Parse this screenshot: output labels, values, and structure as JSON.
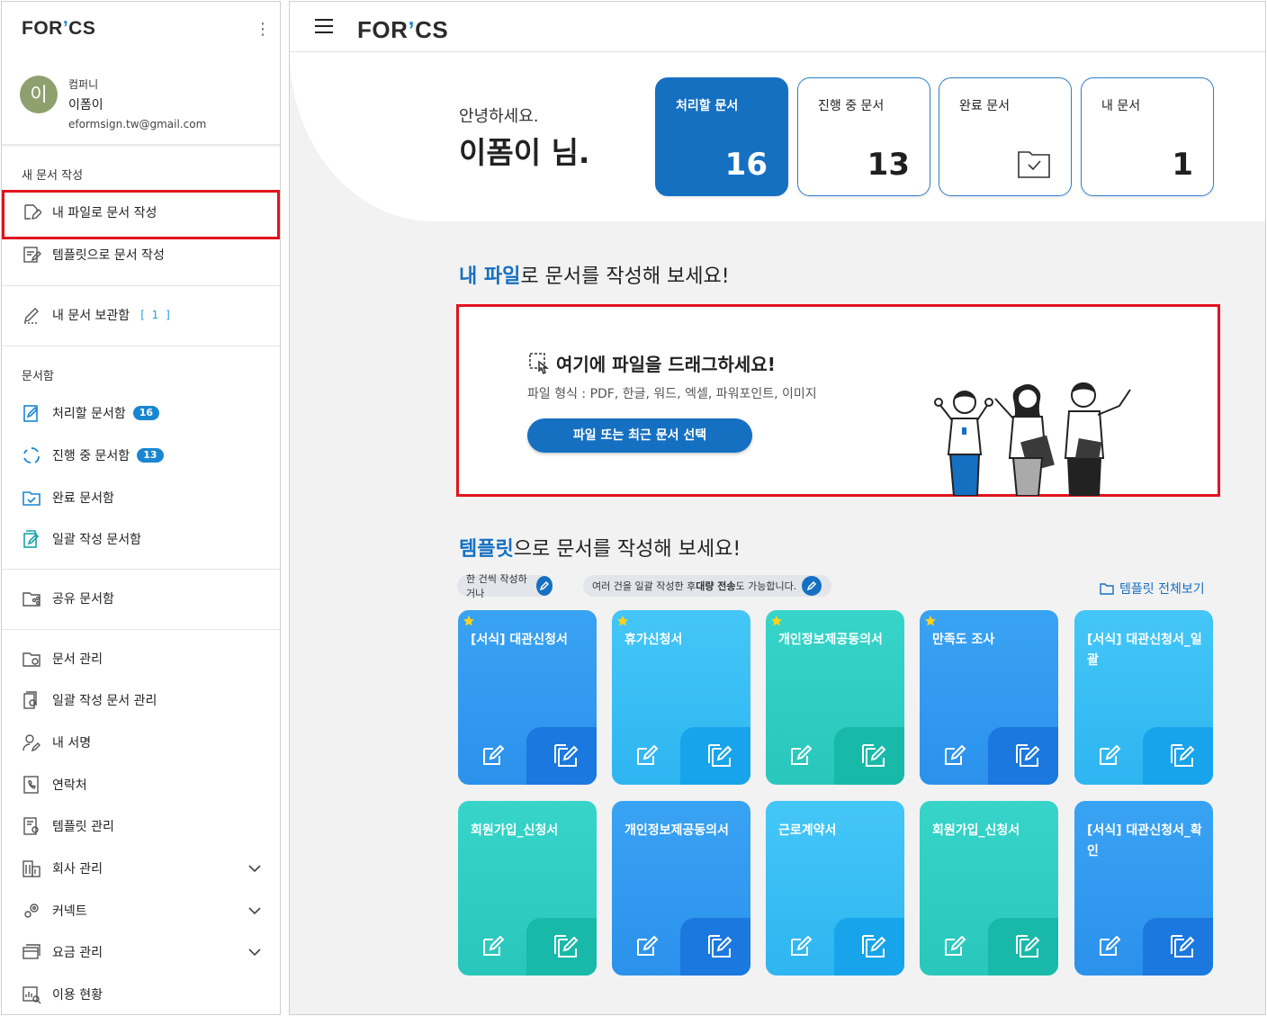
{
  "brand": {
    "logo_text_pre": "FOR",
    "logo_text_arrow": "ʼ",
    "logo_text_post": "CS",
    "accent": "#1570c2",
    "highlight": "#e0141e"
  },
  "sidebar": {
    "avatar_initial": "이",
    "company": "컴퍼니",
    "user_name": "이폼이",
    "email": "eformsign.tw@gmail.com",
    "section_new": "새 문서 작성",
    "new_from_file": "내 파일로 문서 작성",
    "new_from_template": "템플릿으로 문서 작성",
    "my_drafts": "내 문서 보관함",
    "my_drafts_count": "[ 1 ]",
    "section_box": "문서함",
    "todo": "처리할 문서함",
    "todo_count": "16",
    "inprogress": "진행 중 문서함",
    "inprogress_count": "13",
    "completed": "완료 문서함",
    "bulk": "일괄 작성 문서함",
    "shared": "공유 문서함",
    "doc_manage": "문서 관리",
    "bulk_manage": "일괄 작성 문서 관리",
    "my_signature": "내 서명",
    "contacts": "연락처",
    "template_manage": "템플릿 관리",
    "company_manage": "회사 관리",
    "connect": "커넥트",
    "billing": "요금 관리",
    "usage": "이용 현황"
  },
  "header": {
    "greeting": "안녕하세요.",
    "name": "이폼이 님."
  },
  "stats": [
    {
      "label": "처리할 문서",
      "value": "16"
    },
    {
      "label": "진행 중 문서",
      "value": "13"
    },
    {
      "label": "완료 문서",
      "icon": "folder-check-icon"
    },
    {
      "label": "내 문서",
      "value": "1"
    }
  ],
  "file_section": {
    "heading_highlight": "내 파일",
    "heading_rest": "로 문서를 작성해 보세요!",
    "drop_title": "여기에 파일을 드래그하세요!",
    "drop_subtitle": "파일 형식 : PDF, 한글, 워드, 엑셀, 파워포인트, 이미지",
    "drop_button": "파일 또는 최근 문서 선택"
  },
  "template_section": {
    "heading_highlight": "템플릿",
    "heading_rest": "으로 문서를 작성해 보세요!",
    "hint_single": "한 건씩 작성하거나",
    "hint_bulk_pre": "여러 건을 일괄 작성한 후 ",
    "hint_bulk_bold": "대량 전송",
    "hint_bulk_post": "도 가능합니다.",
    "view_all": "템플릿 전체보기",
    "cards": [
      {
        "title": "[서식] 대관신청서",
        "starred": true
      },
      {
        "title": "휴가신청서",
        "starred": true
      },
      {
        "title": "개인정보제공동의서",
        "starred": true
      },
      {
        "title": "만족도 조사",
        "starred": true
      },
      {
        "title": "[서식] 대관신청서_일괄",
        "starred": false
      },
      {
        "title": "회원가입_신청서",
        "starred": false
      },
      {
        "title": "개인정보제공동의서",
        "starred": false
      },
      {
        "title": "근로계약서",
        "starred": false
      },
      {
        "title": "회원가입_신청서",
        "starred": false
      },
      {
        "title": "[서식] 대관신청서_확인",
        "starred": false
      }
    ]
  }
}
